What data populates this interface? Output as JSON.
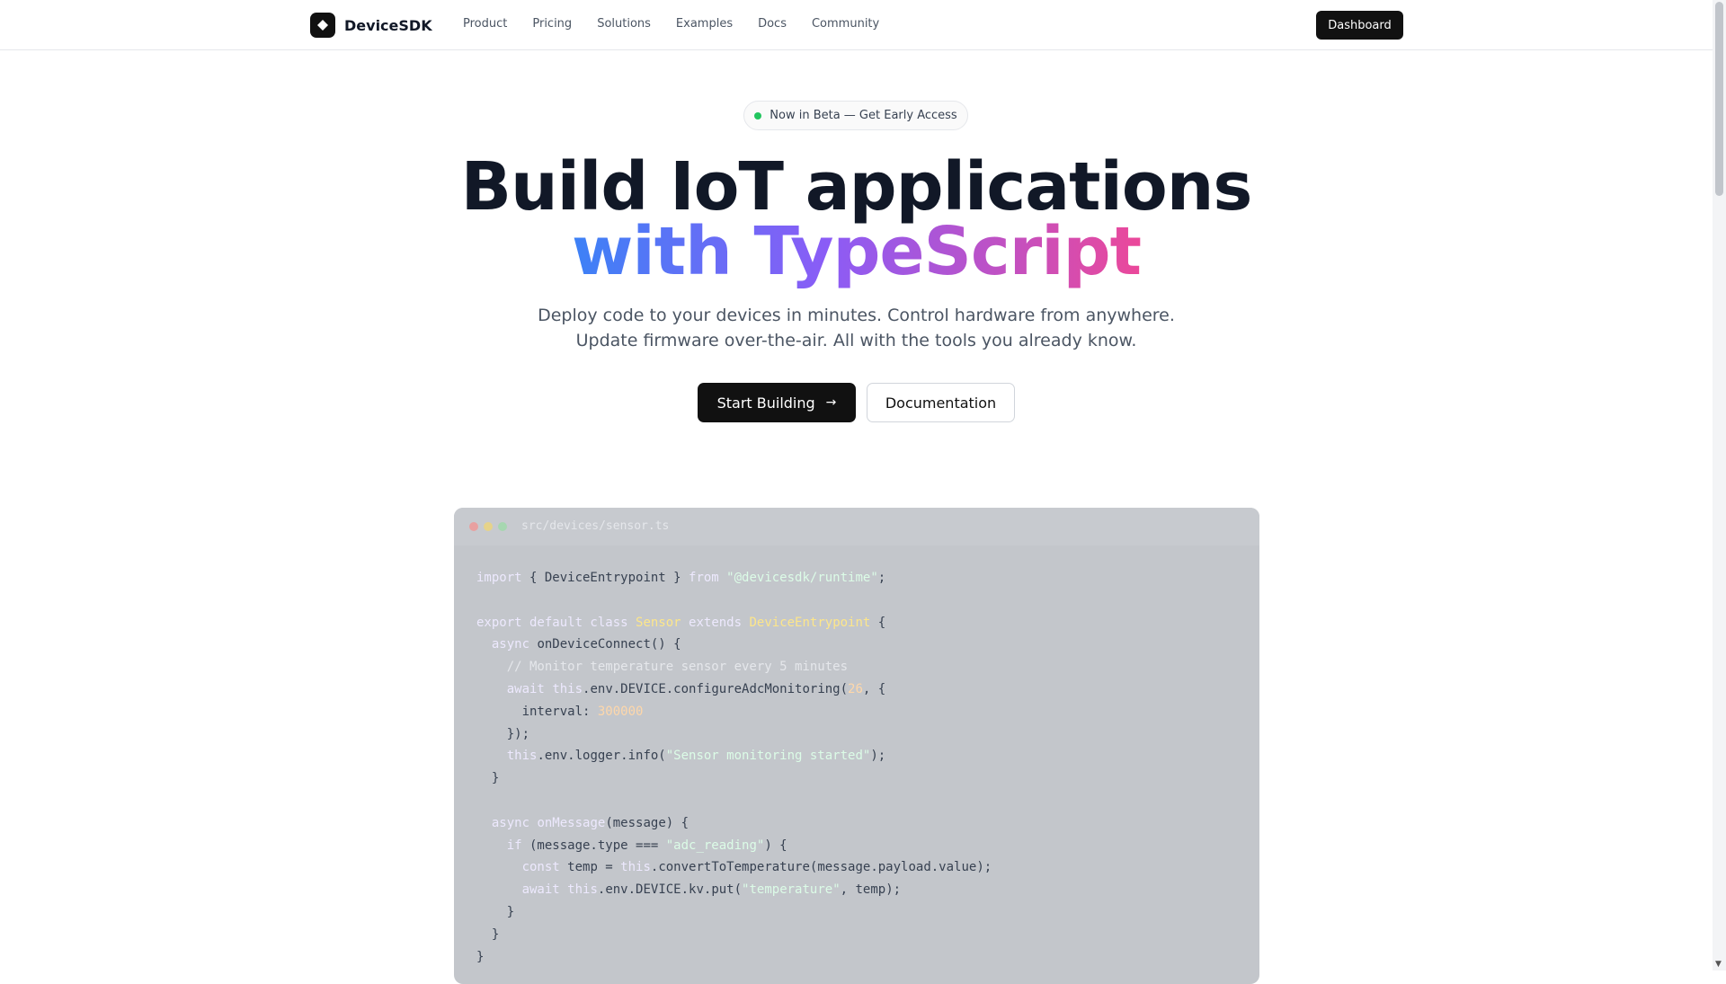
{
  "nav": {
    "brand": "DeviceSDK",
    "links": [
      "Product",
      "Pricing",
      "Solutions",
      "Examples",
      "Docs",
      "Community"
    ],
    "dashboard_label": "Dashboard"
  },
  "hero": {
    "badge": "Now in Beta — Get Early Access",
    "title_line1": "Build IoT applications",
    "title_line2": "with TypeScript",
    "subtitle_line1": "Deploy code to your devices in minutes. Control hardware from anywhere.",
    "subtitle_line2": "Update firmware over-the-air. All with the tools you already know.",
    "primary_cta": "Start Building",
    "secondary_cta": "Documentation"
  },
  "code_window": {
    "file_name": "src/devices/sensor.ts",
    "lines": [
      [
        [
          "kw",
          "import"
        ],
        [
          "p",
          " { DeviceEntrypoint } "
        ],
        [
          "kw",
          "from"
        ],
        [
          "p",
          " "
        ],
        [
          "str",
          "\"@devicesdk/runtime\""
        ],
        [
          "p",
          ";"
        ]
      ],
      [],
      [
        [
          "kw",
          "export default class"
        ],
        [
          "p",
          " "
        ],
        [
          "cls",
          "Sensor"
        ],
        [
          "p",
          " "
        ],
        [
          "kw",
          "extends"
        ],
        [
          "p",
          " "
        ],
        [
          "cls",
          "DeviceEntrypoint"
        ],
        [
          "p",
          " {"
        ]
      ],
      [
        [
          "p",
          "  "
        ],
        [
          "kw",
          "async"
        ],
        [
          "p",
          " onDeviceConnect() {"
        ]
      ],
      [
        [
          "cmt",
          "    // Monitor temperature sensor every 5 minutes"
        ]
      ],
      [
        [
          "p",
          "    "
        ],
        [
          "kw",
          "await"
        ],
        [
          "p",
          " "
        ],
        [
          "kw",
          "this"
        ],
        [
          "p",
          ".env.DEVICE.configureAdcMonitoring("
        ],
        [
          "num",
          "26"
        ],
        [
          "p",
          ", {"
        ]
      ],
      [
        [
          "p",
          "      interval: "
        ],
        [
          "num",
          "300000"
        ]
      ],
      [
        [
          "p",
          "    });"
        ]
      ],
      [
        [
          "p",
          "    "
        ],
        [
          "kw",
          "this"
        ],
        [
          "p",
          ".env.logger.info("
        ],
        [
          "str",
          "\"Sensor monitoring started\""
        ],
        [
          "p",
          ");"
        ]
      ],
      [
        [
          "p",
          "  }"
        ]
      ],
      [],
      [
        [
          "p",
          "  "
        ],
        [
          "kw",
          "async"
        ],
        [
          "p",
          " "
        ],
        [
          "kw",
          "onMessage"
        ],
        [
          "p",
          "(message) {"
        ]
      ],
      [
        [
          "p",
          "    "
        ],
        [
          "kw",
          "if"
        ],
        [
          "p",
          " (message.type === "
        ],
        [
          "str",
          "\"adc_reading\""
        ],
        [
          "p",
          ") {"
        ]
      ],
      [
        [
          "p",
          "      "
        ],
        [
          "kw",
          "const"
        ],
        [
          "p",
          " temp = "
        ],
        [
          "kw",
          "this"
        ],
        [
          "p",
          ".convertToTemperature(message.payload.value);"
        ]
      ],
      [
        [
          "p",
          "      "
        ],
        [
          "kw",
          "await"
        ],
        [
          "p",
          " "
        ],
        [
          "kw",
          "this"
        ],
        [
          "p",
          ".env.DEVICE.kv.put("
        ],
        [
          "str",
          "\"temperature\""
        ],
        [
          "p",
          ", temp);"
        ]
      ],
      [
        [
          "p",
          "    }"
        ]
      ],
      [
        [
          "p",
          "  }"
        ]
      ],
      [
        [
          "p",
          "}"
        ]
      ]
    ]
  },
  "colors": {
    "accent_dark": "#111111",
    "gradient_start": "#3b82f6",
    "gradient_mid": "#8b5cf6",
    "gradient_end": "#ec4899",
    "beta_dot": "#22c55e"
  }
}
